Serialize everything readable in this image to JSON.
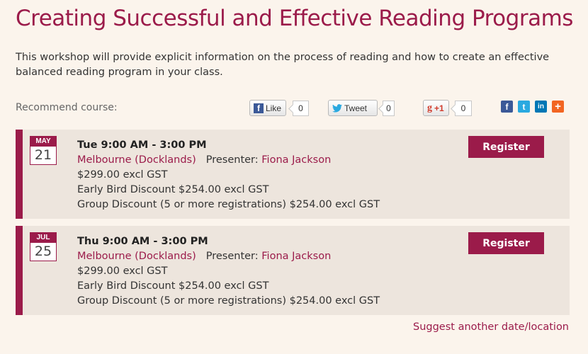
{
  "page": {
    "title": "Creating Successful and Effective Reading Programs",
    "intro": "This workshop will provide explicit information on the process of reading and how to create an effective balanced reading program in your class."
  },
  "recommend": {
    "label": "Recommend course:",
    "like": {
      "label": "Like",
      "icon": "f",
      "count": "0"
    },
    "tweet": {
      "label": "Tweet",
      "icon": "twitter-bird",
      "count": "0"
    },
    "gplus": {
      "label": "+1",
      "icon": "g",
      "count": "0"
    },
    "share_icons": [
      {
        "name": "facebook",
        "glyph": "f",
        "color": "#3b5998"
      },
      {
        "name": "twitter",
        "glyph": "t",
        "color": "#2aa9e0"
      },
      {
        "name": "linkedin",
        "glyph": "in",
        "color": "#0077b5"
      },
      {
        "name": "more",
        "glyph": "+",
        "color": "#f26522"
      }
    ]
  },
  "sessions": [
    {
      "month": "MAY",
      "day": "21",
      "time": "Tue 9:00 AM - 3:00 PM",
      "location": "Melbourne (Docklands)",
      "presenter_label": "Presenter:",
      "presenter": "Fiona Jackson",
      "price": "$299.00 excl GST",
      "early_bird": "Early Bird Discount $254.00 excl GST",
      "group": "Group Discount (5 or more registrations) $254.00 excl GST",
      "register_label": "Register"
    },
    {
      "month": "JUL",
      "day": "25",
      "time": "Thu 9:00 AM - 3:00 PM",
      "location": "Melbourne (Docklands)",
      "presenter_label": "Presenter:",
      "presenter": "Fiona Jackson",
      "price": "$299.00 excl GST",
      "early_bird": "Early Bird Discount $254.00 excl GST",
      "group": "Group Discount (5 or more registrations) $254.00 excl GST",
      "register_label": "Register"
    }
  ],
  "suggest_link": "Suggest another date/location",
  "colors": {
    "accent": "#9b1b4a",
    "background": "#fbf4ec",
    "session_bg": "#ede5dd"
  }
}
